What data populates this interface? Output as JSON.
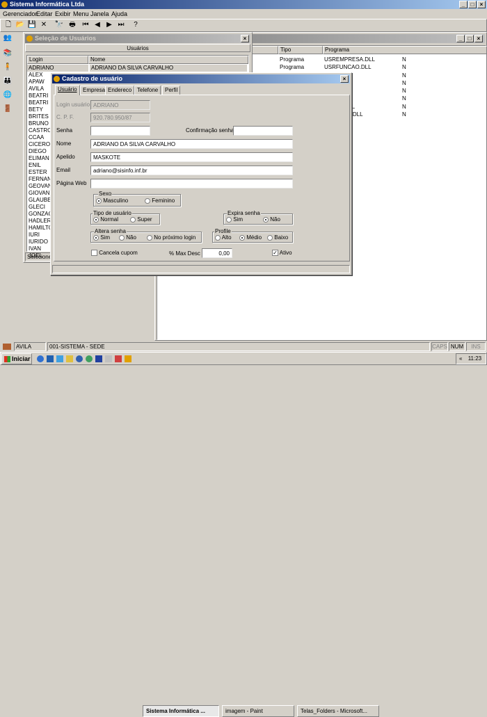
{
  "app": {
    "title": "Sistema Informática Ltda"
  },
  "menu": [
    "Gerenciador",
    "Editar",
    "Exibir",
    "Menu",
    "Janela",
    "Ajuda"
  ],
  "selection_window": {
    "title": "Seleção de Usuários",
    "panel_label": "Usuários",
    "columns": [
      "Login",
      "Nome"
    ],
    "selected_name": "ADRIANO DA SILVA CARVALHO",
    "rows": [
      "ADRIANO",
      "ALEX",
      "APAW",
      "AVILA",
      "BEATRI",
      "BEATRI",
      "BETY",
      "BRITES",
      "BRUNO",
      "CASTRO",
      "CCAA",
      "CICERO",
      "DIEGO",
      "ELIMAN",
      "ENIL",
      "ESTER",
      "FERNAN",
      "GEOVAN",
      "GIOVANI",
      "GLAUBE",
      "GLECI",
      "GONZAG",
      "HADLER",
      "HAMILTO",
      "IURI",
      "IURIDO",
      "IVAN",
      "JOEL"
    ],
    "status": "Selecione"
  },
  "right_window": {
    "columns": [
      "Tipo",
      "Programa"
    ],
    "rows": [
      {
        "tipo": "Programa",
        "programa": "USREMPRESA.DLL",
        "flag": "N"
      },
      {
        "tipo": "Programa",
        "programa": "USRFUNCAO.DLL",
        "flag": "N"
      },
      {
        "tipo": "",
        "programa": ".DLL",
        "flag": "N"
      },
      {
        "tipo": "",
        "programa": "A.DLL",
        "flag": "N"
      },
      {
        "tipo": "",
        "programa": "CAO.DLL",
        "flag": "N"
      },
      {
        "tipo": "",
        "programa": "LL",
        "flag": "N"
      },
      {
        "tipo": "",
        "programa": "TRANS.DLL",
        "flag": "N"
      },
      {
        "tipo": "",
        "programa": "NCTRANS.DLL",
        "flag": "N"
      }
    ]
  },
  "dialog": {
    "title": "Cadastro de usuário",
    "tabs": [
      "Usuário",
      "Empresa",
      "Endereco",
      "Telefone",
      "Perfil"
    ],
    "labels": {
      "login": "Login usuário",
      "cpf": "C. P. F.",
      "senha": "Senha",
      "confirmacao": "Confirmação senha",
      "nome": "Nome",
      "apelido": "Apelido",
      "email": "Email",
      "pagina": "Página Web",
      "cancela": "Cancela cupom",
      "maxdesc": "% Max Desc",
      "ativo": "Ativo"
    },
    "values": {
      "login": "ADRIANO",
      "cpf": "920.780.950/87",
      "senha": "",
      "confirmacao": "",
      "nome": "ADRIANO DA SILVA CARVALHO",
      "apelido": "MASKOTE",
      "email": "adriano@sisinfo.inf.br",
      "pagina": "",
      "maxdesc": "0,00"
    },
    "sexo": {
      "title": "Sexo",
      "options": [
        "Masculino",
        "Feminino"
      ]
    },
    "tipo": {
      "title": "Tipo de usuário",
      "options": [
        "Normal",
        "Super"
      ]
    },
    "expira": {
      "title": "Expira senha",
      "options": [
        "Sim",
        "Não"
      ]
    },
    "altera": {
      "title": "Altera senha",
      "options": [
        "Sim",
        "Não",
        "No próximo login"
      ]
    },
    "profile": {
      "title": "Profile",
      "options": [
        "Alto",
        "Médio",
        "Baixo"
      ]
    }
  },
  "statusbar": {
    "user": "AVILA",
    "company": "001-SISTEMA - SEDE",
    "caps": "CAPS",
    "num": "NUM",
    "ins": "INS"
  },
  "taskbar": {
    "start": "Iniciar",
    "items": [
      "Sistema Informática ...",
      "imagem - Paint",
      "Telas_Folders - Microsoft..."
    ],
    "clock": "11:23"
  }
}
